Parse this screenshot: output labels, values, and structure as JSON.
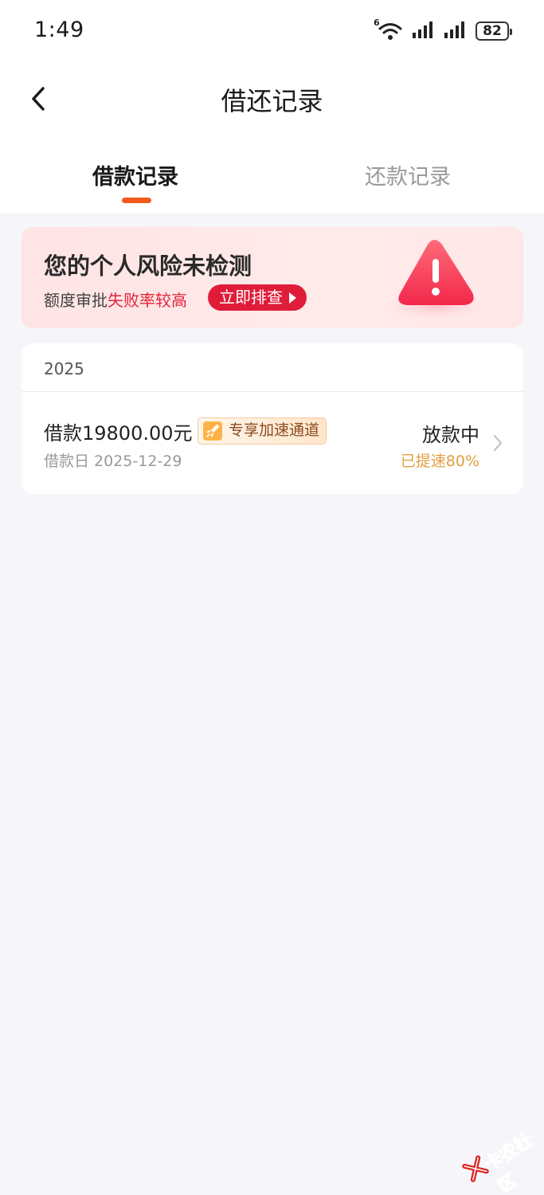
{
  "status_bar": {
    "time": "1:49",
    "battery": "82",
    "network_badge": "6"
  },
  "header": {
    "title": "借还记录",
    "back_icon": "chevron-left-icon"
  },
  "tabs": [
    {
      "label": "借款记录",
      "active": true
    },
    {
      "label": "还款记录",
      "active": false
    }
  ],
  "risk_banner": {
    "title": "您的个人风险未检测",
    "subtitle_prefix": "额度审批",
    "subtitle_highlight": "失败率较高",
    "button_label": "立即排查",
    "icon": "warning-triangle-icon"
  },
  "records": {
    "year": "2025",
    "items": [
      {
        "amount": "借款19800.00元",
        "badge": "专享加速通道",
        "date": "借款日 2025-12-29",
        "status": "放款中",
        "speed": "已提速80%"
      }
    ]
  },
  "watermark": {
    "text": "卡农社区"
  },
  "colors": {
    "accent": "#f25b1d",
    "danger": "#e01d38",
    "speed": "#e0a040",
    "background": "#f6f6fa"
  }
}
